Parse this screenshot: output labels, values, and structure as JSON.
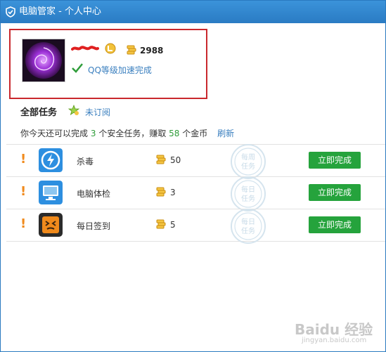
{
  "window": {
    "title": "电脑管家 - 个人中心"
  },
  "profile": {
    "coin_total": "2988",
    "speed_status": "QQ等级加速完成"
  },
  "tasks_section": {
    "title": "全部任务",
    "subscribe_label": "未订阅",
    "summary_prefix": "你今天还可以完成",
    "task_count": "3",
    "summary_mid": "个安全任务，赚取",
    "coin_count": "58",
    "summary_suffix": "个金币",
    "refresh_label": "刷新"
  },
  "tasks": [
    {
      "name": "杀毒",
      "coins": "50",
      "stamp": "每周任务",
      "button": "立即完成",
      "icon": "lightning-icon"
    },
    {
      "name": "电脑体检",
      "coins": "3",
      "stamp": "每日任务",
      "button": "立即完成",
      "icon": "monitor-icon"
    },
    {
      "name": "每日签到",
      "coins": "5",
      "stamp": "每日任务",
      "button": "立即完成",
      "icon": "checkin-icon"
    }
  ],
  "watermark": {
    "text": "Baidu 经验",
    "url": "jingyan.baidu.com"
  },
  "colors": {
    "titlebar": "#2f86d1",
    "highlight_box": "#c9282d",
    "button": "#25a33c",
    "link": "#3a7fbf",
    "number": "#2f9d3a",
    "warning": "#f08a1c"
  }
}
